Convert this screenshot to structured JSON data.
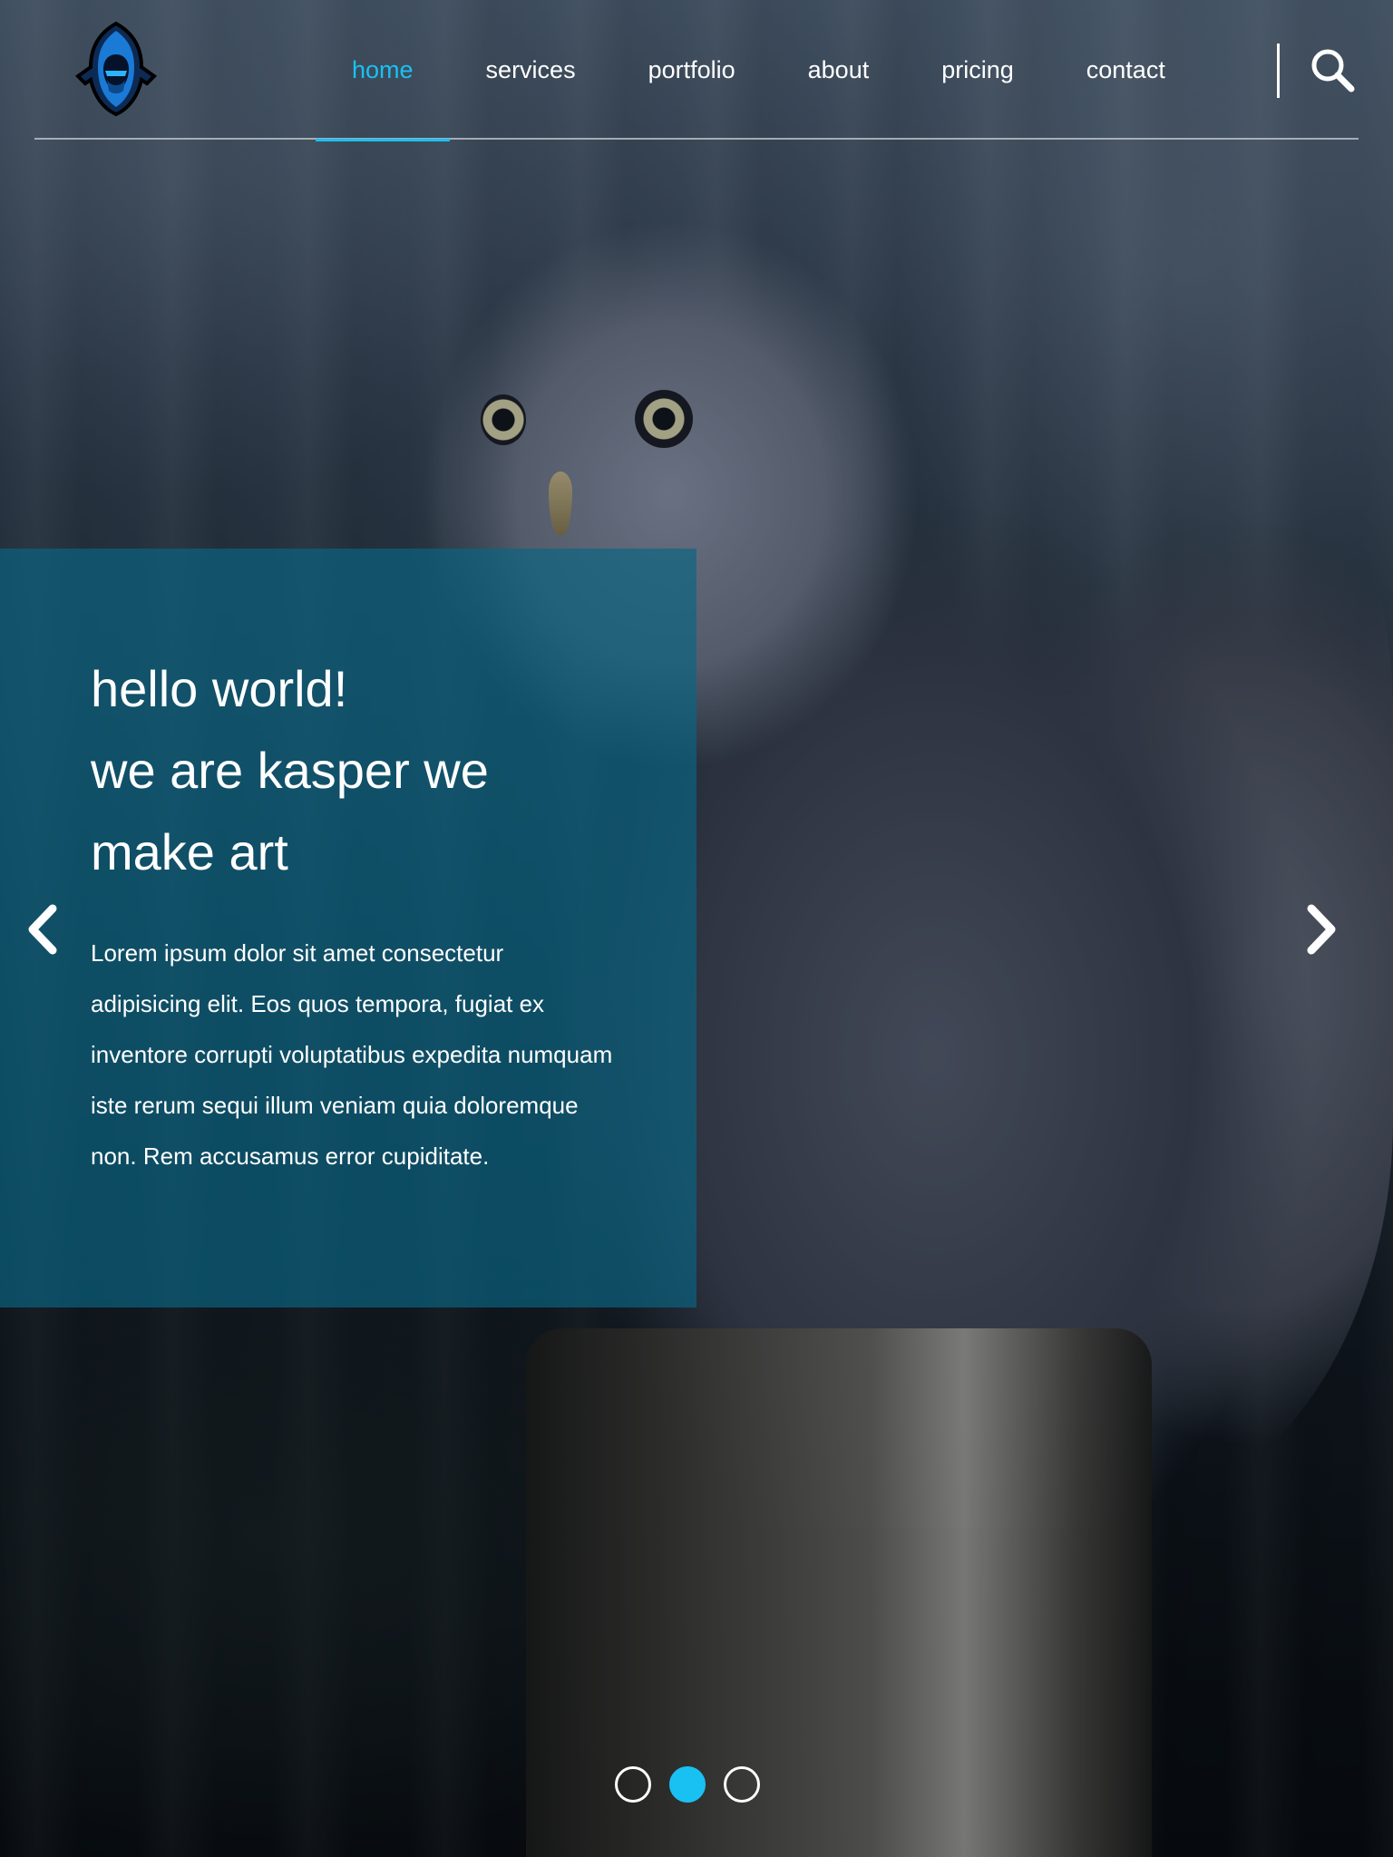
{
  "brand": {
    "logo_icon": "hooded-ninja-logo",
    "accent_color": "#19c1f3"
  },
  "nav": {
    "items": [
      {
        "label": "home",
        "active": true
      },
      {
        "label": "services",
        "active": false
      },
      {
        "label": "portfolio",
        "active": false
      },
      {
        "label": "about",
        "active": false
      },
      {
        "label": "pricing",
        "active": false
      },
      {
        "label": "contact",
        "active": false
      }
    ],
    "search_icon": "search-icon"
  },
  "hero": {
    "headline_line1": "hello world!",
    "headline_line2": "we are kasper we make art",
    "body": "Lorem ipsum dolor sit amet consectetur adipisicing elit. Eos quos tempora, fugiat ex inventore corrupti voluptatibus expedita numquam iste rerum sequi illum veniam quia doloremque non. Rem accusamus error cupiditate.",
    "prev_icon": "chevron-left-icon",
    "next_icon": "chevron-right-icon"
  },
  "slider": {
    "slide_count": 3,
    "active_index": 1
  }
}
